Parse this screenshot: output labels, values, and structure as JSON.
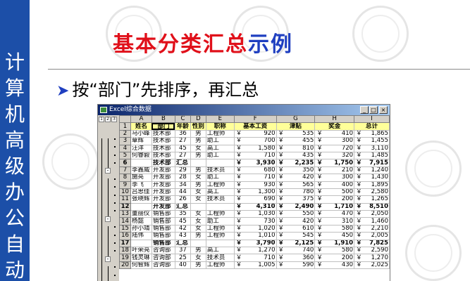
{
  "slide": {
    "sidebar_text": [
      "计",
      "算",
      "机",
      "高",
      "级",
      "办",
      "公",
      "自",
      "动"
    ],
    "title_red": "基本分类汇总",
    "title_blue": "示例",
    "bullet_arrow": "➤",
    "bullet_text": "按“部门”先排序，再汇总"
  },
  "excel": {
    "window_title": "Excel综合数据",
    "btn_min": "_",
    "btn_max": "□",
    "btn_close": "×",
    "outline_levels": [
      "1",
      "2",
      "3"
    ],
    "collapse_symbol": "-",
    "column_letters": [
      "",
      "A",
      "B",
      "C",
      "D",
      "E",
      "F",
      "G",
      "H",
      "I"
    ],
    "currency": "￥",
    "rows": [
      {
        "n": "1",
        "type": "header",
        "cells": [
          "姓名",
          "部门",
          "年龄",
          "性别",
          "职称",
          "基本工资",
          "津贴",
          "奖金",
          "总计"
        ]
      },
      {
        "n": "2",
        "type": "data",
        "cells": [
          "马小峰",
          "技术部",
          "36",
          "男",
          "工程师",
          "920",
          "535",
          "410",
          "1,865"
        ]
      },
      {
        "n": "3",
        "type": "data",
        "cells": [
          "章辉",
          "技术部",
          "27",
          "男",
          "助工",
          "700",
          "455",
          "300",
          "1,455"
        ]
      },
      {
        "n": "4",
        "type": "data",
        "cells": [
          "汪洋",
          "技术部",
          "45",
          "女",
          "高工",
          "1,580",
          "810",
          "720",
          "3,110"
        ]
      },
      {
        "n": "5",
        "type": "data",
        "cells": [
          "何睿毅",
          "技术部",
          "27",
          "男",
          "助工",
          "710",
          "435",
          "320",
          "1,485"
        ]
      },
      {
        "n": "6",
        "type": "subtotal",
        "cells": [
          "",
          "技术部",
          "汇总",
          "",
          "",
          "3,930",
          "2,235",
          "1,750",
          "7,915"
        ]
      },
      {
        "n": "7",
        "type": "data",
        "cells": [
          "李鑫威",
          "开发部",
          "29",
          "男",
          "技术员",
          "680",
          "350",
          "210",
          "1,240"
        ]
      },
      {
        "n": "8",
        "type": "data",
        "cells": [
          "施亮",
          "开发部",
          "28",
          "女",
          "助工",
          "710",
          "420",
          "300",
          "1,430"
        ]
      },
      {
        "n": "9",
        "type": "data",
        "cells": [
          "李飞",
          "开发部",
          "34",
          "男",
          "工程师",
          "930",
          "565",
          "400",
          "1,895"
        ]
      },
      {
        "n": "10",
        "type": "data",
        "cells": [
          "吕思佳",
          "开发部",
          "44",
          "女",
          "高工",
          "1,300",
          "780",
          "500",
          "2,580"
        ]
      },
      {
        "n": "11",
        "type": "data",
        "cells": [
          "张晓辉",
          "开发部",
          "26",
          "女",
          "技术员",
          "690",
          "375",
          "200",
          "1,265"
        ]
      },
      {
        "n": "12",
        "type": "subtotal",
        "cells": [
          "",
          "开发部",
          "汇总",
          "",
          "",
          "4,310",
          "2,490",
          "1,710",
          "8,510"
        ]
      },
      {
        "n": "13",
        "type": "data",
        "cells": [
          "董丽仪",
          "销售部",
          "35",
          "女",
          "工程师",
          "1,030",
          "550",
          "470",
          "2,050"
        ]
      },
      {
        "n": "14",
        "type": "data",
        "cells": [
          "杨懿",
          "销售部",
          "45",
          "女",
          "助工",
          "730",
          "420",
          "310",
          "1,460"
        ]
      },
      {
        "n": "15",
        "type": "data",
        "cells": [
          "孙小靖",
          "销售部",
          "42",
          "女",
          "工程师",
          "1,020",
          "610",
          "580",
          "2,210"
        ]
      },
      {
        "n": "16",
        "type": "data",
        "cells": [
          "陆伟",
          "销售部",
          "43",
          "男",
          "工程师",
          "1,010",
          "545",
          "450",
          "2,005"
        ]
      },
      {
        "n": "17",
        "type": "subtotal",
        "cells": [
          "",
          "销售部",
          "汇总",
          "",
          "",
          "3,790",
          "2,125",
          "1,910",
          "7,825"
        ]
      },
      {
        "n": "18",
        "type": "data",
        "cells": [
          "叶荣亮",
          "咨询部",
          "37",
          "男",
          "高工",
          "1,270",
          "740",
          "580",
          "2,590"
        ]
      },
      {
        "n": "19",
        "type": "data",
        "cells": [
          "钱灵琳",
          "咨询部",
          "25",
          "女",
          "技术员",
          "710",
          "360",
          "200",
          "1,270"
        ]
      },
      {
        "n": "20",
        "type": "data",
        "cells": [
          "何智辉",
          "咨询部",
          "40",
          "男",
          "工程师",
          "1,005",
          "590",
          "430",
          "2,025"
        ]
      }
    ]
  }
}
